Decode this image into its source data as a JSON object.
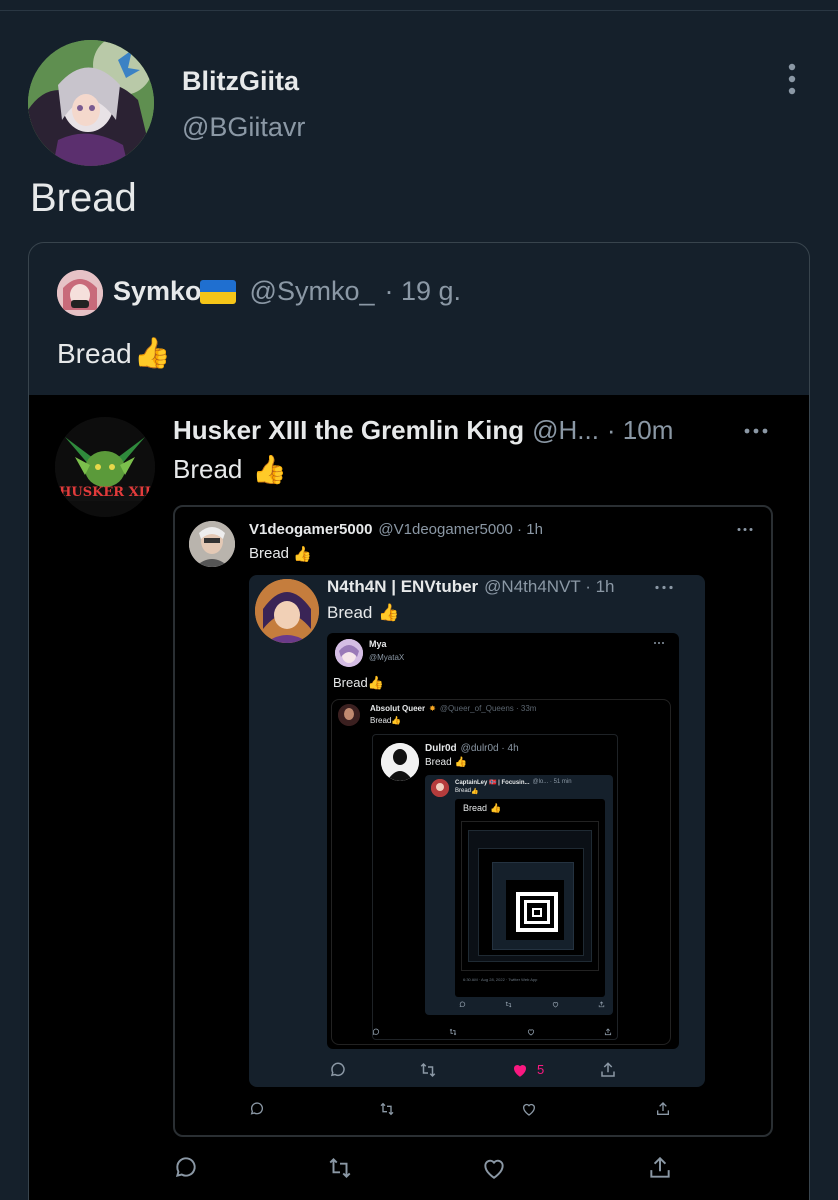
{
  "main": {
    "name": "BlitzGiita",
    "handle": "@BGiitavr",
    "text": "Bread"
  },
  "quote": {
    "name": "Symko",
    "flag": "🇺🇦",
    "handle": "@Symko_",
    "time": "· 19 g.",
    "text": "Bread",
    "emoji": "👍"
  },
  "level1": {
    "name": "Husker XIII the Gremlin King",
    "handle": "@H...",
    "time": "· 10m",
    "text": "Bread",
    "emoji": "👍",
    "avatar_text": "HUSKER XII"
  },
  "level2": {
    "name": "V1deogamer5000",
    "handle": "@V1deogamer5000 · 1h",
    "text": "Bread",
    "emoji": "👍"
  },
  "level3": {
    "name": "N4th4N | ENVtuber",
    "handle": "@N4th4NVT · 1h",
    "text": "Bread",
    "emoji": "👍",
    "like_count": "5"
  },
  "level4": {
    "name": "Mya",
    "handle": "@MyataX",
    "text": "Bread",
    "emoji": "👍"
  },
  "level5": {
    "name": "Absolut Queer",
    "handle": "@Queer_of_Queens · 33m",
    "text": "Bread",
    "emoji": "👍"
  },
  "level6": {
    "name": "Dulr0d",
    "handle": "@dulr0d · 4h",
    "text": "Bread",
    "emoji": "👍"
  },
  "level7": {
    "name": "CaptainLey 🇳🇴 | Focusin...",
    "handle": "@lo... · 51 min",
    "text": "Bread",
    "emoji": "👍"
  },
  "level8": {
    "text": "Bread",
    "emoji": "👍",
    "timestamp": "6:30 AM · Aug 28, 2022 · Twitter Web App"
  },
  "colors": {
    "background": "#15202b",
    "text": "#e7e9ea",
    "muted": "#8b98a5",
    "border": "#38444d",
    "like_active": "#f91880"
  }
}
